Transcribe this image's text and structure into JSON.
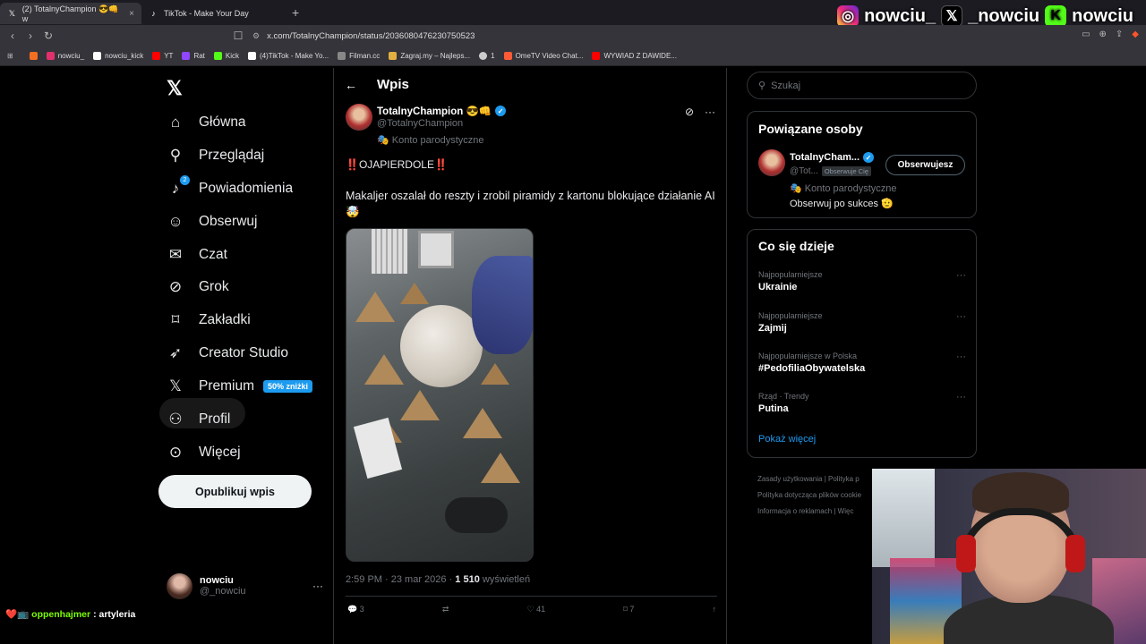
{
  "browser": {
    "tabs": [
      {
        "title": "(2) TotalnyChampion 😎👊 w",
        "active": true,
        "icon": "x-icon"
      },
      {
        "title": "TikTok - Make Your Day",
        "active": false,
        "icon": "tiktok-icon"
      }
    ],
    "url": "x.com/TotalnyChampion/status/2036080476230750523",
    "bookmarks": [
      {
        "label": "",
        "color": "#f26f21"
      },
      {
        "label": "nowciu_",
        "color": "#e1306c"
      },
      {
        "label": "nowciu_kick",
        "color": "#ffffff"
      },
      {
        "label": "YT",
        "color": "#ff0000"
      },
      {
        "label": "Rat",
        "color": "#9146ff"
      },
      {
        "label": "Kick",
        "color": "#53fc18"
      },
      {
        "label": "(4)TikTok - Make Yo...",
        "color": "#ffffff"
      },
      {
        "label": "Filman.cc",
        "color": "#888888"
      },
      {
        "label": "Zagraj.my – Najleps...",
        "color": "#e0b040"
      },
      {
        "label": "1",
        "color": "#cccccc"
      },
      {
        "label": "OmeTV Video Chat...",
        "color": "#ff5a36"
      },
      {
        "label": "WYWIAD Z DAWIDE...",
        "color": "#ff0000"
      }
    ]
  },
  "socials": {
    "instagram": "nowciu_",
    "x": "_nowciu",
    "kick": "nowciu"
  },
  "sidebar": {
    "items": [
      {
        "label": "Główna",
        "icon": "home-icon"
      },
      {
        "label": "Przeglądaj",
        "icon": "search-icon"
      },
      {
        "label": "Powiadomienia",
        "icon": "bell-icon",
        "badge": "2"
      },
      {
        "label": "Obserwuj",
        "icon": "follow-icon"
      },
      {
        "label": "Czat",
        "icon": "mail-icon"
      },
      {
        "label": "Grok",
        "icon": "grok-icon"
      },
      {
        "label": "Zakładki",
        "icon": "bookmark-icon"
      },
      {
        "label": "Creator Studio",
        "icon": "rocket-icon"
      },
      {
        "label": "Premium",
        "icon": "x-icon",
        "promo": "50% zniżki"
      },
      {
        "label": "Profil",
        "icon": "user-icon"
      },
      {
        "label": "Więcej",
        "icon": "more-icon"
      }
    ],
    "post_button": "Opublikuj wpis",
    "account": {
      "name": "nowciu",
      "handle": "@_nowciu"
    }
  },
  "main": {
    "header_title": "Wpis",
    "post": {
      "author": "TotalnyChampion 😎👊",
      "handle": "@TotalnyChampion",
      "parody_label": "🎭 Konto parodystyczne",
      "headline": "‼️OJAPIERDOLE‼️",
      "body": "Makaljer oszalał do reszty i zrobil piramidy z kartonu blokujące działanie AI 🤯",
      "time": "2:59 PM · 23 mar 2026 · ",
      "views_count": "1 510",
      "views_label": "wyświetleń",
      "stats": {
        "replies": "3",
        "reposts": "",
        "likes": "41",
        "bookmarks": "7"
      }
    }
  },
  "right": {
    "search_placeholder": "Szukaj",
    "related": {
      "title": "Powiązane osoby",
      "name": "TotalnyCham...",
      "handle": "@Tot...",
      "follows_you": "Obserwuje Cię",
      "follow_button": "Obserwujesz",
      "parody": "🎭 Konto parodystyczne",
      "bio": "Obserwuj po sukces 🫡"
    },
    "trends": {
      "title": "Co się dzieje",
      "items": [
        {
          "category": "Najpopularniejsze",
          "topic": "Ukrainie"
        },
        {
          "category": "Najpopularniejsze",
          "topic": "Zajmij"
        },
        {
          "category": "Najpopularniejsze w Polska",
          "topic": "#PedofiliaObywatelska"
        },
        {
          "category": "Rząd · Trendy",
          "topic": "Putina"
        }
      ],
      "show_more": "Pokaż więcej"
    },
    "footer": {
      "line1": "Zasady użytkowania  |  Polityka p",
      "line2": "Polityka dotycząca plików cookie",
      "line3": "Informacja o reklamach  |  Więc"
    }
  },
  "chat_overlay": {
    "badges": "❤️📺",
    "user": "oppenhajmer",
    "message": ": artyleria"
  }
}
